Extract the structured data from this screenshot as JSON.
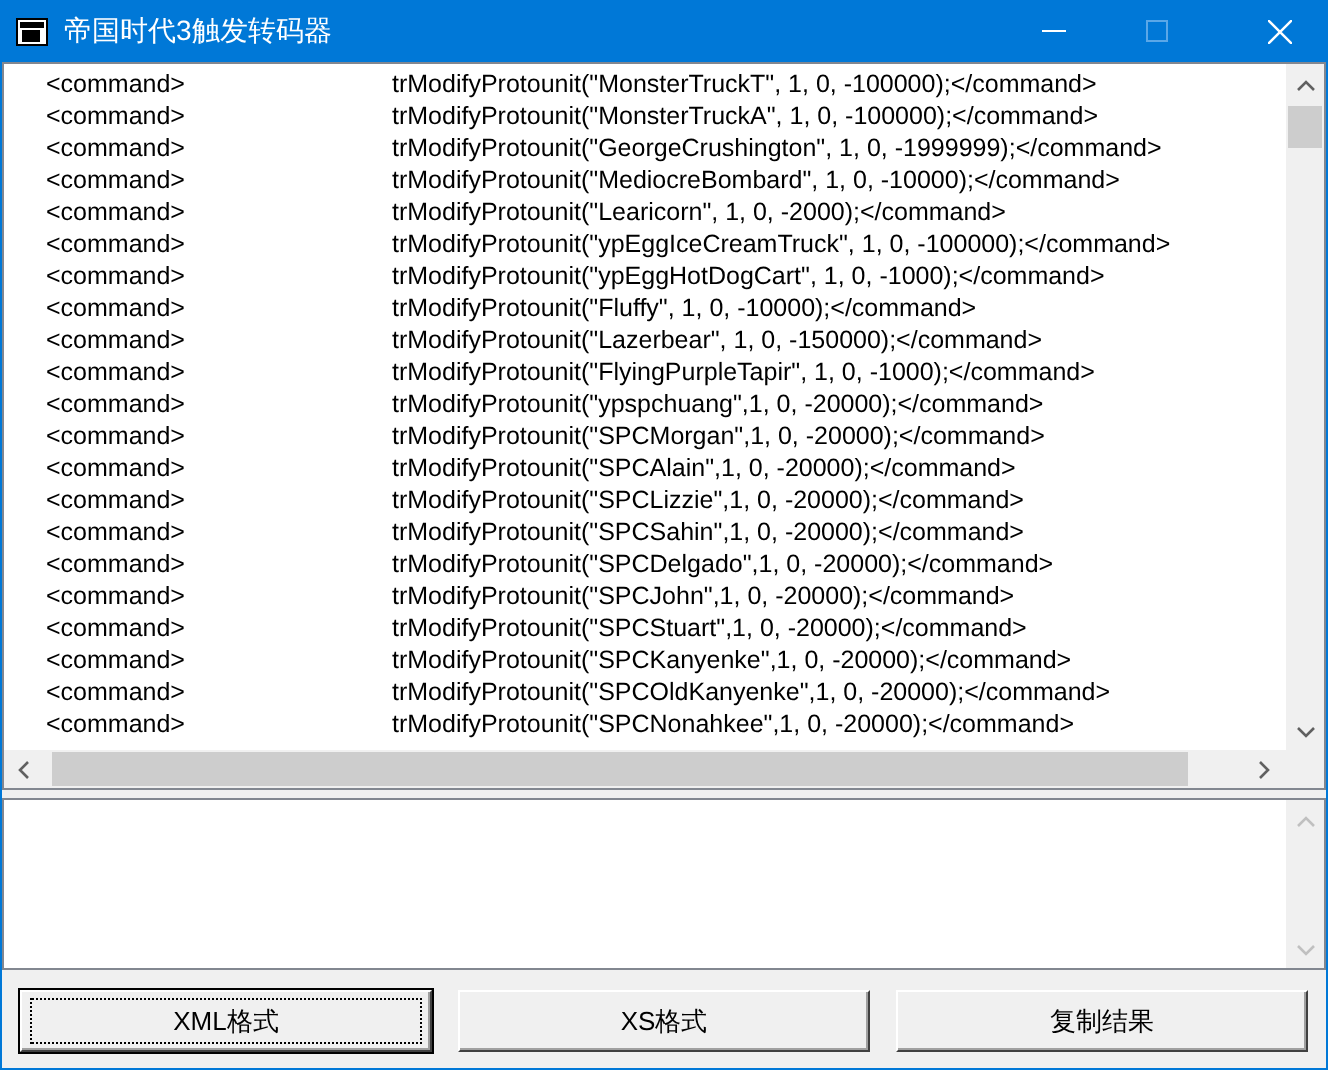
{
  "window": {
    "title": "帝国时代3触发转码器"
  },
  "lines": [
    {
      "tag": "<command>",
      "code": "trModifyProtounit(\"MonsterTruckT\", 1, 0, -100000);</command>"
    },
    {
      "tag": "<command>",
      "code": "trModifyProtounit(\"MonsterTruckA\", 1, 0, -100000);</command>"
    },
    {
      "tag": "<command>",
      "code": "trModifyProtounit(\"GeorgeCrushington\", 1, 0, -1999999);</command>"
    },
    {
      "tag": "<command>",
      "code": "trModifyProtounit(\"MediocreBombard\", 1, 0, -10000);</command>"
    },
    {
      "tag": "<command>",
      "code": "trModifyProtounit(\"Learicorn\", 1, 0, -2000);</command>"
    },
    {
      "tag": "<command>",
      "code": "trModifyProtounit(\"ypEggIceCreamTruck\", 1, 0, -100000);</command>"
    },
    {
      "tag": "<command>",
      "code": "trModifyProtounit(\"ypEggHotDogCart\", 1, 0, -1000);</command>"
    },
    {
      "tag": "<command>",
      "code": "trModifyProtounit(\"Fluffy\", 1, 0, -10000);</command>"
    },
    {
      "tag": "<command>",
      "code": "trModifyProtounit(\"Lazerbear\", 1, 0, -150000);</command>"
    },
    {
      "tag": "<command>",
      "code": "trModifyProtounit(\"FlyingPurpleTapir\", 1, 0, -1000);</command>"
    },
    {
      "tag": "<command>",
      "code": "trModifyProtounit(\"ypspchuang\",1, 0, -20000);</command>"
    },
    {
      "tag": "<command>",
      "code": "trModifyProtounit(\"SPCMorgan\",1, 0, -20000);</command>"
    },
    {
      "tag": "<command>",
      "code": "trModifyProtounit(\"SPCAlain\",1, 0, -20000);</command>"
    },
    {
      "tag": "<command>",
      "code": "trModifyProtounit(\"SPCLizzie\",1, 0, -20000);</command>"
    },
    {
      "tag": "<command>",
      "code": "trModifyProtounit(\"SPCSahin\",1, 0, -20000);</command>"
    },
    {
      "tag": "<command>",
      "code": "trModifyProtounit(\"SPCDelgado\",1, 0, -20000);</command>"
    },
    {
      "tag": "<command>",
      "code": "trModifyProtounit(\"SPCJohn\",1, 0, -20000);</command>"
    },
    {
      "tag": "<command>",
      "code": "trModifyProtounit(\"SPCStuart\",1, 0, -20000);</command>"
    },
    {
      "tag": "<command>",
      "code": "trModifyProtounit(\"SPCKanyenke\",1, 0, -20000);</command>"
    },
    {
      "tag": "<command>",
      "code": "trModifyProtounit(\"SPCOldKanyenke\",1, 0, -20000);</command>"
    },
    {
      "tag": "<command>",
      "code": "trModifyProtounit(\"SPCNonahkee\",1, 0, -20000);</command>"
    }
  ],
  "buttons": [
    {
      "label": "XML格式",
      "focused": true
    },
    {
      "label": "XS格式",
      "focused": false
    },
    {
      "label": "复制结果",
      "focused": false
    }
  ]
}
